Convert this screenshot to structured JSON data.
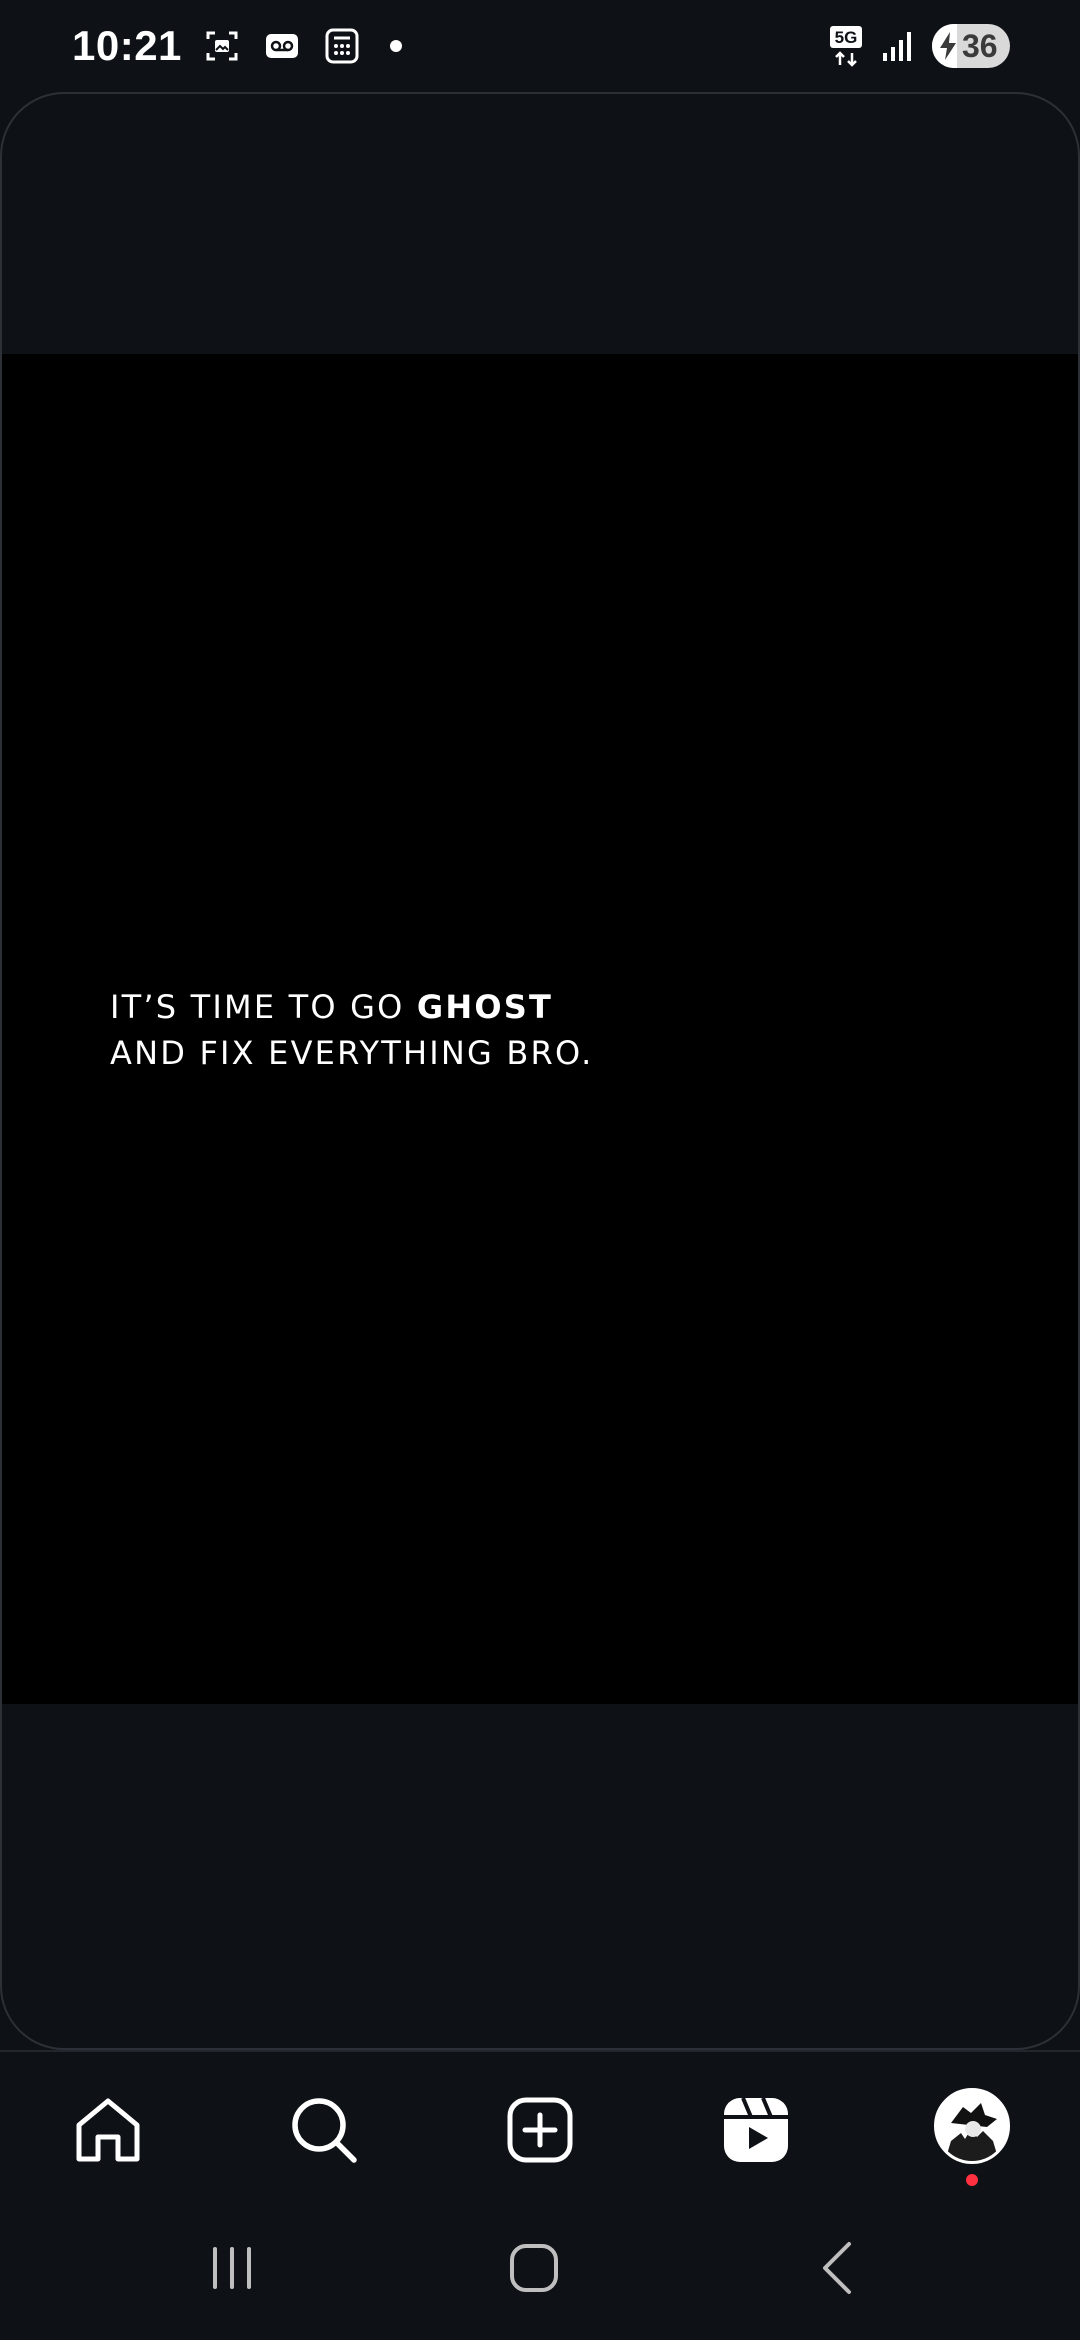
{
  "status_bar": {
    "time": "10:21",
    "network": "5G",
    "battery_level": "36",
    "icons": [
      "screenshot-icon",
      "voicemail-icon",
      "calculator-icon",
      "notification-dot",
      "5g-icon",
      "signal-icon",
      "battery-charging-icon"
    ]
  },
  "post": {
    "caption_line1_prefix": "IT’S TIME TO GO ",
    "caption_line1_bold": "GHOST",
    "caption_line2": "AND FIX EVERYTHING BRO."
  },
  "bottom_nav": {
    "items": [
      "home-icon",
      "search-icon",
      "create-icon",
      "reels-icon",
      "profile-avatar"
    ],
    "has_notification": true
  },
  "system_nav": {
    "buttons": [
      "recents-button",
      "home-button",
      "back-button"
    ]
  },
  "colors": {
    "background": "#0e1116",
    "media_background": "#000000",
    "text": "#ffffff",
    "notification": "#ff3040"
  }
}
